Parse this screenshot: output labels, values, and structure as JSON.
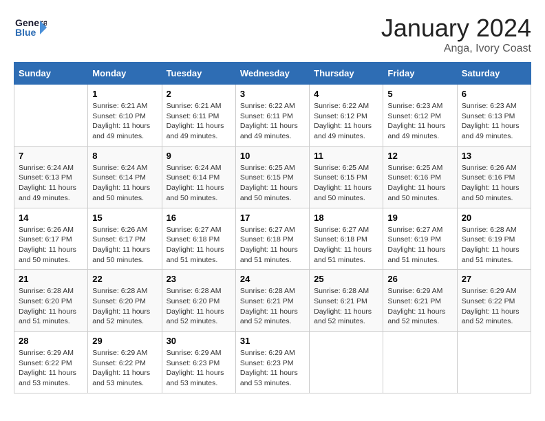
{
  "logo": {
    "line1": "General",
    "line2": "Blue"
  },
  "title": "January 2024",
  "subtitle": "Anga, Ivory Coast",
  "days_of_week": [
    "Sunday",
    "Monday",
    "Tuesday",
    "Wednesday",
    "Thursday",
    "Friday",
    "Saturday"
  ],
  "weeks": [
    [
      {
        "day": "",
        "info": ""
      },
      {
        "day": "1",
        "info": "Sunrise: 6:21 AM\nSunset: 6:10 PM\nDaylight: 11 hours\nand 49 minutes."
      },
      {
        "day": "2",
        "info": "Sunrise: 6:21 AM\nSunset: 6:11 PM\nDaylight: 11 hours\nand 49 minutes."
      },
      {
        "day": "3",
        "info": "Sunrise: 6:22 AM\nSunset: 6:11 PM\nDaylight: 11 hours\nand 49 minutes."
      },
      {
        "day": "4",
        "info": "Sunrise: 6:22 AM\nSunset: 6:12 PM\nDaylight: 11 hours\nand 49 minutes."
      },
      {
        "day": "5",
        "info": "Sunrise: 6:23 AM\nSunset: 6:12 PM\nDaylight: 11 hours\nand 49 minutes."
      },
      {
        "day": "6",
        "info": "Sunrise: 6:23 AM\nSunset: 6:13 PM\nDaylight: 11 hours\nand 49 minutes."
      }
    ],
    [
      {
        "day": "7",
        "info": "Sunrise: 6:24 AM\nSunset: 6:13 PM\nDaylight: 11 hours\nand 49 minutes."
      },
      {
        "day": "8",
        "info": "Sunrise: 6:24 AM\nSunset: 6:14 PM\nDaylight: 11 hours\nand 50 minutes."
      },
      {
        "day": "9",
        "info": "Sunrise: 6:24 AM\nSunset: 6:14 PM\nDaylight: 11 hours\nand 50 minutes."
      },
      {
        "day": "10",
        "info": "Sunrise: 6:25 AM\nSunset: 6:15 PM\nDaylight: 11 hours\nand 50 minutes."
      },
      {
        "day": "11",
        "info": "Sunrise: 6:25 AM\nSunset: 6:15 PM\nDaylight: 11 hours\nand 50 minutes."
      },
      {
        "day": "12",
        "info": "Sunrise: 6:25 AM\nSunset: 6:16 PM\nDaylight: 11 hours\nand 50 minutes."
      },
      {
        "day": "13",
        "info": "Sunrise: 6:26 AM\nSunset: 6:16 PM\nDaylight: 11 hours\nand 50 minutes."
      }
    ],
    [
      {
        "day": "14",
        "info": "Sunrise: 6:26 AM\nSunset: 6:17 PM\nDaylight: 11 hours\nand 50 minutes."
      },
      {
        "day": "15",
        "info": "Sunrise: 6:26 AM\nSunset: 6:17 PM\nDaylight: 11 hours\nand 50 minutes."
      },
      {
        "day": "16",
        "info": "Sunrise: 6:27 AM\nSunset: 6:18 PM\nDaylight: 11 hours\nand 51 minutes."
      },
      {
        "day": "17",
        "info": "Sunrise: 6:27 AM\nSunset: 6:18 PM\nDaylight: 11 hours\nand 51 minutes."
      },
      {
        "day": "18",
        "info": "Sunrise: 6:27 AM\nSunset: 6:18 PM\nDaylight: 11 hours\nand 51 minutes."
      },
      {
        "day": "19",
        "info": "Sunrise: 6:27 AM\nSunset: 6:19 PM\nDaylight: 11 hours\nand 51 minutes."
      },
      {
        "day": "20",
        "info": "Sunrise: 6:28 AM\nSunset: 6:19 PM\nDaylight: 11 hours\nand 51 minutes."
      }
    ],
    [
      {
        "day": "21",
        "info": "Sunrise: 6:28 AM\nSunset: 6:20 PM\nDaylight: 11 hours\nand 51 minutes."
      },
      {
        "day": "22",
        "info": "Sunrise: 6:28 AM\nSunset: 6:20 PM\nDaylight: 11 hours\nand 52 minutes."
      },
      {
        "day": "23",
        "info": "Sunrise: 6:28 AM\nSunset: 6:20 PM\nDaylight: 11 hours\nand 52 minutes."
      },
      {
        "day": "24",
        "info": "Sunrise: 6:28 AM\nSunset: 6:21 PM\nDaylight: 11 hours\nand 52 minutes."
      },
      {
        "day": "25",
        "info": "Sunrise: 6:28 AM\nSunset: 6:21 PM\nDaylight: 11 hours\nand 52 minutes."
      },
      {
        "day": "26",
        "info": "Sunrise: 6:29 AM\nSunset: 6:21 PM\nDaylight: 11 hours\nand 52 minutes."
      },
      {
        "day": "27",
        "info": "Sunrise: 6:29 AM\nSunset: 6:22 PM\nDaylight: 11 hours\nand 52 minutes."
      }
    ],
    [
      {
        "day": "28",
        "info": "Sunrise: 6:29 AM\nSunset: 6:22 PM\nDaylight: 11 hours\nand 53 minutes."
      },
      {
        "day": "29",
        "info": "Sunrise: 6:29 AM\nSunset: 6:22 PM\nDaylight: 11 hours\nand 53 minutes."
      },
      {
        "day": "30",
        "info": "Sunrise: 6:29 AM\nSunset: 6:23 PM\nDaylight: 11 hours\nand 53 minutes."
      },
      {
        "day": "31",
        "info": "Sunrise: 6:29 AM\nSunset: 6:23 PM\nDaylight: 11 hours\nand 53 minutes."
      },
      {
        "day": "",
        "info": ""
      },
      {
        "day": "",
        "info": ""
      },
      {
        "day": "",
        "info": ""
      }
    ]
  ]
}
